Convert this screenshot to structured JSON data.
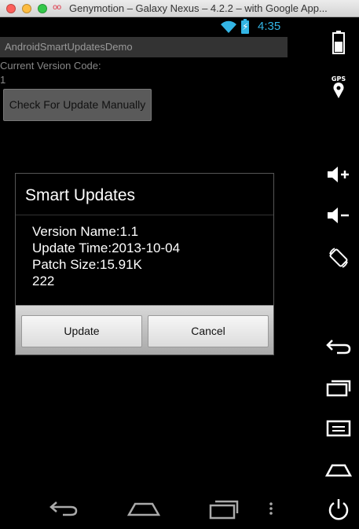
{
  "window": {
    "title": "Genymotion – Galaxy Nexus – 4.2.2 – with Google App...",
    "logo": "oo"
  },
  "statusbar": {
    "time": "4:35",
    "icons": [
      "wifi-icon",
      "battery-charging-icon"
    ],
    "accent_color": "#33b5e5"
  },
  "app": {
    "title": "AndroidSmartUpdatesDemo",
    "version_label": "Current Version Code:",
    "version_code": "1",
    "check_button": "Check For Update Manually"
  },
  "dialog": {
    "title": "Smart Updates",
    "lines": [
      "Version Name:1.1",
      "Update Time:2013-10-04",
      "Patch Size:15.91K",
      "222"
    ],
    "update_button": "Update",
    "cancel_button": "Cancel"
  },
  "navbar": {
    "icons": [
      "back-icon",
      "home-icon",
      "recent-apps-icon",
      "menu-overflow-icon"
    ]
  },
  "side_panel": {
    "gps_label": "GPS",
    "icons": [
      "battery-icon",
      "gps-icon",
      "volume-up-icon",
      "volume-down-icon",
      "rotate-icon",
      "back-icon",
      "recent-apps-icon",
      "menu-icon",
      "home-icon",
      "power-icon"
    ]
  }
}
